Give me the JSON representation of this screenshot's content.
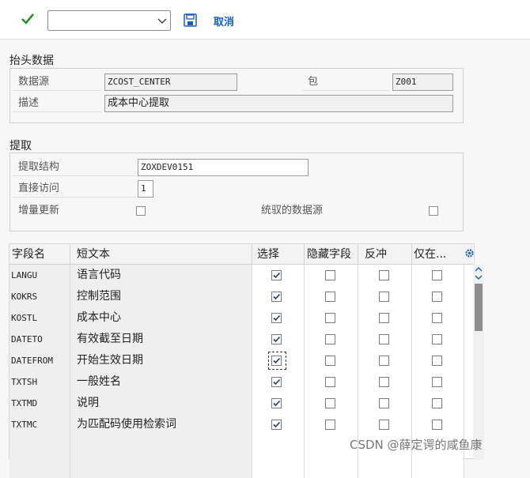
{
  "toolbar": {
    "command_value": "",
    "cancel_label": "取消"
  },
  "header_section": {
    "title": "抬头数据",
    "datasource_label": "数据源",
    "datasource_value": "ZCOST_CENTER",
    "package_label": "包",
    "package_value": "Z001",
    "description_label": "描述",
    "description_value": "成本中心提取"
  },
  "extract_section": {
    "title": "提取",
    "structure_label": "提取结构",
    "structure_value": "ZOXDEV0151",
    "direct_access_label": "直接访问",
    "direct_access_value": "1",
    "delta_label": "增量更新",
    "delta_checked": false,
    "unified_label": "统驭的数据源",
    "unified_checked": false
  },
  "table": {
    "headers": [
      "字段名",
      "短文本",
      "选择",
      "隐藏字段",
      "反冲",
      "仅在..."
    ],
    "rows": [
      {
        "field": "LANGU",
        "text": "语言代码",
        "select": true,
        "hide": false,
        "invert": false,
        "only": false
      },
      {
        "field": "KOKRS",
        "text": "控制范围",
        "select": true,
        "hide": false,
        "invert": false,
        "only": false
      },
      {
        "field": "KOSTL",
        "text": "成本中心",
        "select": true,
        "hide": false,
        "invert": false,
        "only": false
      },
      {
        "field": "DATETO",
        "text": "有效截至日期",
        "select": true,
        "hide": false,
        "invert": false,
        "only": false
      },
      {
        "field": "DATEFROM",
        "text": "开始生效日期",
        "select": true,
        "hide": false,
        "invert": false,
        "only": false
      },
      {
        "field": "TXTSH",
        "text": "一般姓名",
        "select": true,
        "hide": false,
        "invert": false,
        "only": false
      },
      {
        "field": "TXTMD",
        "text": "说明",
        "select": true,
        "hide": false,
        "invert": false,
        "only": false
      },
      {
        "field": "TXTMC",
        "text": "为匹配码使用检索词",
        "select": true,
        "hide": false,
        "invert": false,
        "only": false
      }
    ]
  },
  "watermark": "CSDN @薛定谔的咸鱼康",
  "colors": {
    "accent": "#1a5eb3",
    "check": "#2f8f2f"
  }
}
